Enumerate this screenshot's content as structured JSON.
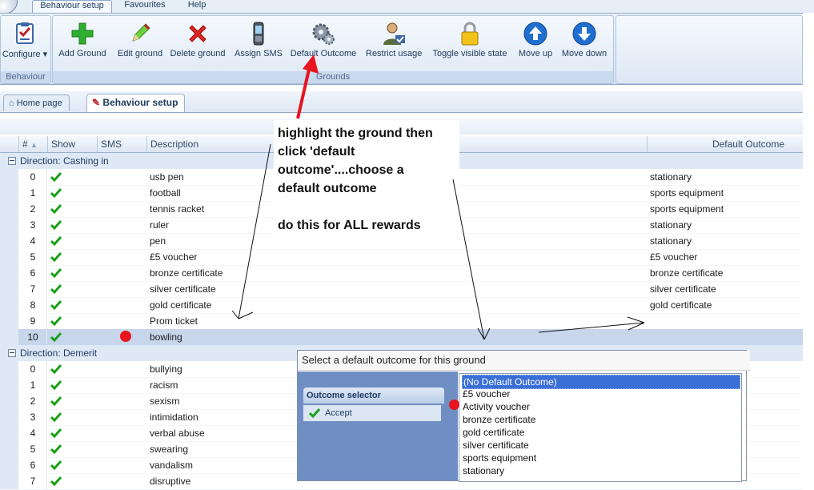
{
  "ribbon_tabs": [
    "Behaviour setup",
    "Favourites",
    "Help"
  ],
  "ribbon": {
    "groups": [
      {
        "label": "Behaviour",
        "buttons": [
          {
            "label": "Configure",
            "icon": "checklist-icon"
          }
        ]
      },
      {
        "label": "Grounds",
        "buttons": [
          {
            "label": "Add Ground",
            "icon": "plus-icon"
          },
          {
            "label": "Edit ground",
            "icon": "pencil-icon"
          },
          {
            "label": "Delete ground",
            "icon": "delete-x-icon"
          },
          {
            "label": "Assign SMS",
            "icon": "mobile-phone-icon"
          },
          {
            "label": "Default Outcome",
            "icon": "gears-icon"
          },
          {
            "label": "Restrict usage",
            "icon": "restricted-user-icon"
          },
          {
            "label": "Toggle visible state",
            "icon": "padlock-icon"
          },
          {
            "label": "Move up",
            "icon": "arrow-up-icon"
          },
          {
            "label": "Move down",
            "icon": "arrow-down-icon"
          }
        ]
      }
    ]
  },
  "doc_tabs": [
    {
      "label": "Home page",
      "icon": "home-icon",
      "active": false
    },
    {
      "label": "Behaviour setup",
      "icon": "pen-icon",
      "active": true
    }
  ],
  "grid": {
    "title": "Behaviour setup",
    "columns": [
      "#",
      "Show",
      "SMS",
      "Description",
      "Default Outcome"
    ],
    "groups": [
      {
        "title": "Direction: Cashing in",
        "rows": [
          {
            "num": "0",
            "desc": "usb pen",
            "outcome": "stationary"
          },
          {
            "num": "1",
            "desc": "football",
            "outcome": "sports equipment"
          },
          {
            "num": "2",
            "desc": "tennis racket",
            "outcome": "sports equipment"
          },
          {
            "num": "3",
            "desc": "ruler",
            "outcome": "stationary"
          },
          {
            "num": "4",
            "desc": "pen",
            "outcome": "stationary"
          },
          {
            "num": "5",
            "desc": "£5 voucher",
            "outcome": "£5 voucher"
          },
          {
            "num": "6",
            "desc": "bronze certificate",
            "outcome": "bronze certificate"
          },
          {
            "num": "7",
            "desc": "silver certificate",
            "outcome": "silver certificate"
          },
          {
            "num": "8",
            "desc": "gold certificate",
            "outcome": "gold certificate"
          },
          {
            "num": "9",
            "desc": "Prom ticket",
            "outcome": ""
          },
          {
            "num": "10",
            "desc": "bowling",
            "outcome": "",
            "selected": true
          }
        ]
      },
      {
        "title": "Direction: Demerit",
        "rows": [
          {
            "num": "0",
            "desc": "bullying",
            "outcome": ""
          },
          {
            "num": "1",
            "desc": "racism",
            "outcome": ""
          },
          {
            "num": "2",
            "desc": "sexism",
            "outcome": ""
          },
          {
            "num": "3",
            "desc": "intimidation",
            "outcome": ""
          },
          {
            "num": "4",
            "desc": "verbal abuse",
            "outcome": ""
          },
          {
            "num": "5",
            "desc": "swearing",
            "outcome": ""
          },
          {
            "num": "6",
            "desc": "vandalism",
            "outcome": ""
          },
          {
            "num": "7",
            "desc": "disruptive",
            "outcome": ""
          }
        ]
      }
    ]
  },
  "popup": {
    "title": "Select a default outcome for this ground",
    "selector_header": "Outcome selector",
    "accept_label": "Accept",
    "options": [
      "(No Default Outcome)",
      "£5 voucher",
      "Activity voucher",
      "bronze certificate",
      "gold certificate",
      "silver certificate",
      "sports equipment",
      "stationary"
    ],
    "selected_index": 0
  },
  "annotation": {
    "line1": "highlight the ground then",
    "line2": "click 'default",
    "line3": "outcome'....choose a",
    "line4": "default outcome",
    "line5": "do this for ALL rewards"
  },
  "colors": {
    "accent": "#3a6fd8",
    "ribbon": "#dae6f4",
    "selected_row": "#c7d6ea",
    "check": "#1aa01a",
    "annotation_arrow": "#e8141e"
  }
}
